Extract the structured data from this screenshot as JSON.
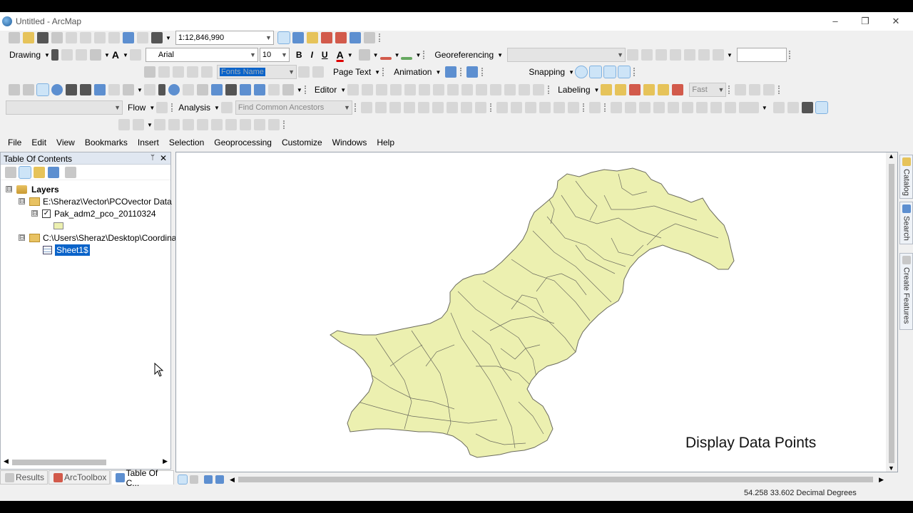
{
  "window": {
    "title": "Untitled - ArcMap",
    "minimize": "–",
    "restore": "❐",
    "close": "✕"
  },
  "toolbar1": {
    "scale": "1:12,846,990"
  },
  "draw_toolbar": {
    "drawing_label": "Drawing",
    "font_name": "Arial",
    "font_size": "10",
    "bold": "B",
    "italic": "I",
    "underline": "U",
    "font_color": "A",
    "georef_label": "Georeferencing"
  },
  "toolbar3": {
    "layer_field": "Fonts Name",
    "page_text": "Page Text",
    "animation": "Animation",
    "snapping": "Snapping"
  },
  "toolbar4": {
    "editor": "Editor",
    "labeling": "Labeling",
    "fast": "Fast"
  },
  "toolbar5": {
    "flow": "Flow",
    "analysis": "Analysis",
    "find_ancestors": "Find Common Ancestors"
  },
  "menubar": [
    "File",
    "Edit",
    "View",
    "Bookmarks",
    "Insert",
    "Selection",
    "Geoprocessing",
    "Customize",
    "Windows",
    "Help"
  ],
  "toc": {
    "title": "Table Of Contents",
    "pin": "ᛘ",
    "close": "✕",
    "layers_label": "Layers",
    "folder1": "E:\\Sheraz\\Vector\\PCOvector Data",
    "layer1": "Pak_adm2_pco_20110324",
    "folder2": "C:\\Users\\Sheraz\\Desktop\\Coordinat",
    "table1": "Sheet1$",
    "expander_open": "⊟",
    "check": "✓"
  },
  "bottom_tabs": [
    {
      "label": "Results"
    },
    {
      "label": "ArcToolbox"
    },
    {
      "label": "Table Of C..."
    }
  ],
  "map": {
    "caption": "Display Data Points",
    "fill_color": "#ecf0b0",
    "line_color": "#6b6b5e"
  },
  "right_dock": {
    "catalog": "Catalog",
    "search": "Search",
    "create_features": "Create Features"
  },
  "status": {
    "coordinates": "54.258  33.602 Decimal Degrees"
  }
}
